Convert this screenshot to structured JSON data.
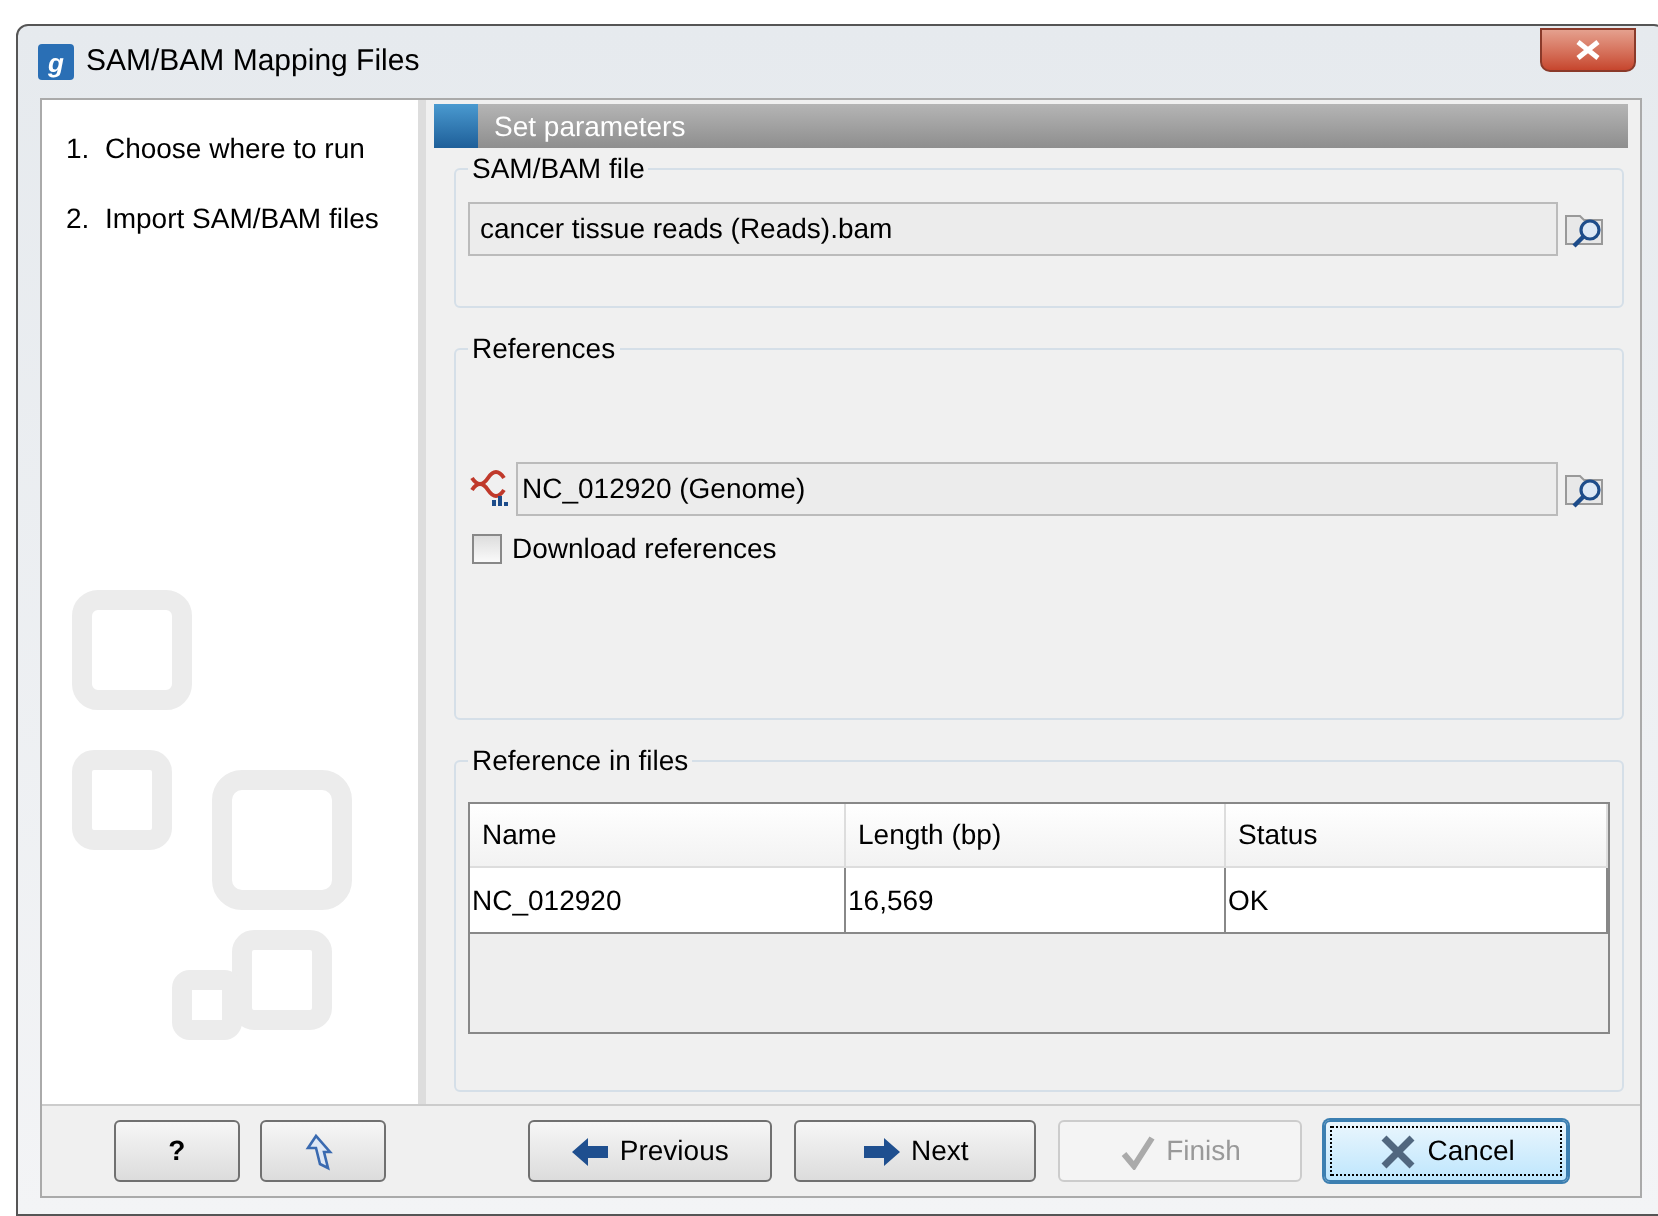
{
  "window": {
    "logo": "g",
    "title": "SAM/BAM Mapping Files"
  },
  "steps": [
    "1.  Choose where to run",
    "2.  Import SAM/BAM files"
  ],
  "panel_title": "Set parameters",
  "sam_bam_file": {
    "label": "SAM/BAM file",
    "value": "cancer tissue reads (Reads).bam"
  },
  "references": {
    "label": "References",
    "value": "NC_012920 (Genome)",
    "download_references": {
      "label": "Download references",
      "checked": false
    }
  },
  "reference_in_files": {
    "label": "Reference in files",
    "columns": [
      "Name",
      "Length (bp)",
      "Status"
    ],
    "rows": [
      [
        "NC_012920",
        "16,569",
        "OK"
      ]
    ]
  },
  "buttons": [
    {
      "kind": "help",
      "label": "?",
      "disabled": false,
      "focused": false
    },
    {
      "kind": "reset",
      "disabled": false,
      "focused": false
    },
    {
      "kind": "previous",
      "label": "Previous",
      "disabled": false,
      "focused": false
    },
    {
      "kind": "next",
      "label": "Next",
      "disabled": false,
      "focused": false
    },
    {
      "kind": "finish",
      "label": "Finish",
      "disabled": true,
      "focused": false
    },
    {
      "kind": "cancel",
      "label": "Cancel",
      "disabled": false,
      "focused": true
    }
  ]
}
